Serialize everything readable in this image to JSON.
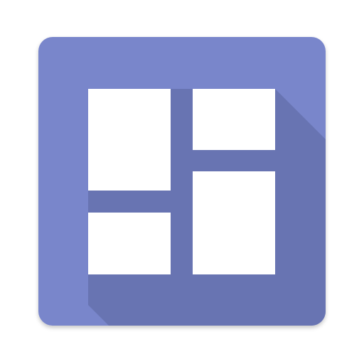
{
  "icon": {
    "name": "dashboard-grid-icon",
    "colors": {
      "base": "#7986CB",
      "long_shadow": "#6874B2",
      "tile": "#FFFFFF",
      "page_background": "#FFFFFF"
    }
  }
}
